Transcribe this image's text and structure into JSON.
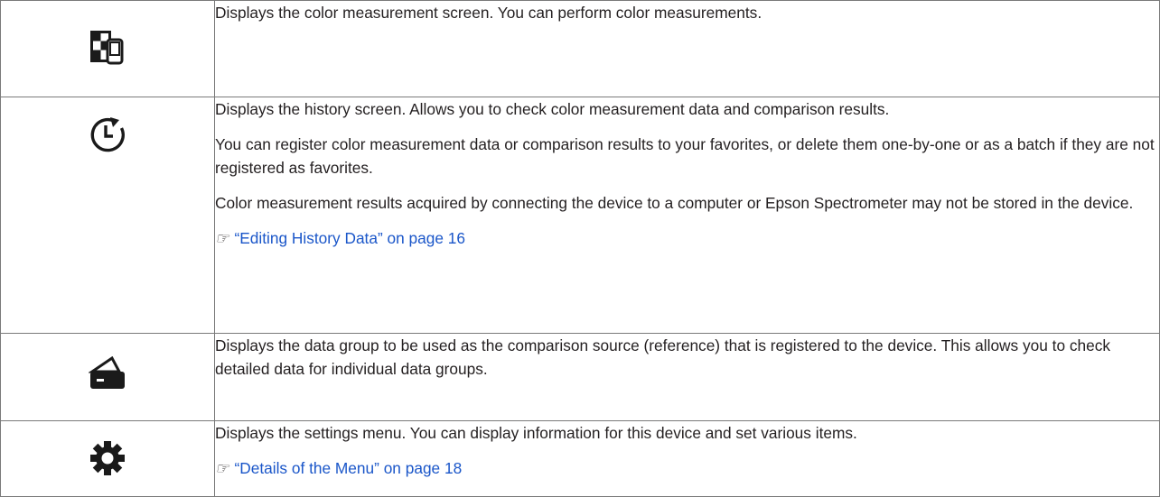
{
  "rows": [
    {
      "icon": "color-measurement-icon",
      "lines": [
        "Displays the color measurement screen. You can perform color measurements."
      ]
    },
    {
      "icon": "history-icon",
      "lines": [
        "Displays the history screen. Allows you to check color measurement data and comparison results.",
        "You can register color measurement data or comparison results to your favorites, or delete them one-by-one or as a batch if they are not registered as favorites.",
        "Color measurement results acquired by connecting the device to a computer or Epson Spectrometer may not be stored in the device."
      ],
      "xref_text": "“Editing History Data” on page 16"
    },
    {
      "icon": "reference-data-icon",
      "lines": [
        "Displays the data group to be used as the comparison source (reference) that is registered to the device. This allows you to check detailed data for individual data groups."
      ]
    },
    {
      "icon": "settings-gear-icon",
      "lines": [
        "Displays the settings menu. You can display information for this device and set various items."
      ],
      "xref_text": "“Details of the Menu” on page 18"
    }
  ],
  "xref_symbol": "☞",
  "colors": {
    "border": "#7a7a7a",
    "text": "#231f20",
    "link": "#1a56c9",
    "icon": "#1a1a1a"
  }
}
